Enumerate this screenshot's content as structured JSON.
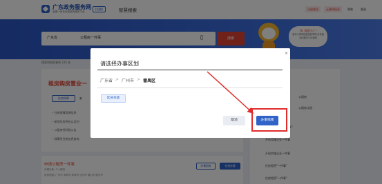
{
  "header": {
    "logo_title": "广东政务服务网",
    "logo_subtitle": "全国一体化在线政务服务平台",
    "switch_label": "[切换]",
    "smart_search": "智慧搜索",
    "top_links": [
      "注册登录",
      "无障碍阅读",
      "帮助",
      "登录"
    ]
  },
  "banner": {
    "region": "广东省",
    "search_value": "公租房一件事",
    "search_button": "搜索",
    "bubble_title": "Hi, 我是小广!",
    "bubble_text": "我可以帮你快速找到事项,办事遇到问题可以问我哦"
  },
  "content": {
    "breadcrumb": "搜索到相关事项 335 条",
    "card_title": "租房购房置业一",
    "tab_a": "住房保障",
    "tab_b": "安",
    "bullets": [
      "住房保障资源信息",
      "新型住房供应以及利",
      "公租房领补贴公告",
      "政策性住房信息查询"
    ],
    "sub_title": "申请公租房一件事",
    "sub_meta": "办理对象: 个人服务",
    "sub_meta2": "适用范围: 广州市 深圳市 珠海市 汕头市 佛山市 韶关市",
    "sub_btn1": "办事指南",
    "sub_btn2": "在线办理",
    "side_items": [
      "公租房",
      "公租房认租",
      "个人\"一件事\"",
      "开启设施企业一件事",
      "开启实施企业一件事",
      "住房租赁\"一件事\"",
      "住房租赁\"一件事\""
    ]
  },
  "modal": {
    "title": "请选择办事区划",
    "path": [
      "广东省",
      "广州市",
      "番禺区"
    ],
    "path_separator": ">",
    "district_tag": "区县本级",
    "close_label": "×",
    "cancel_label": "取消",
    "confirm_label": "办事指南"
  },
  "colors": {
    "primary": "#2f63c8",
    "accent": "#e04535",
    "highlight": "#e02b2b"
  }
}
